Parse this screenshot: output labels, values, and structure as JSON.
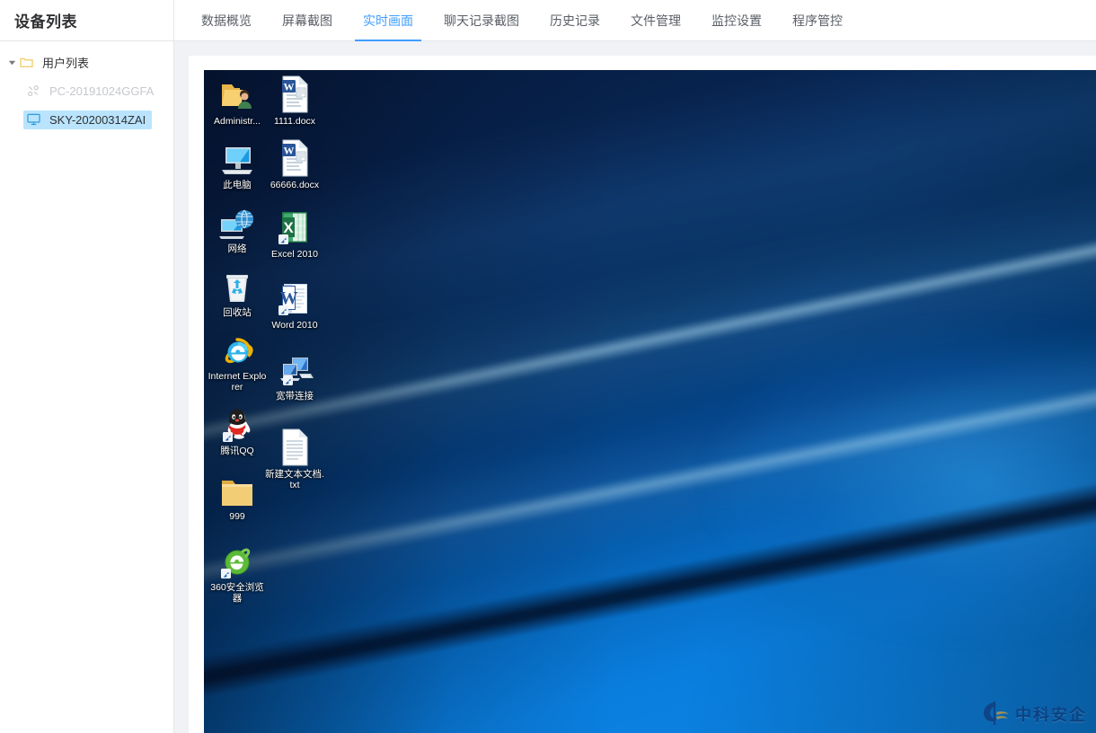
{
  "sidebar": {
    "title": "设备列表",
    "tree": {
      "root": {
        "label": "用户列表",
        "icon": "folder-icon",
        "expanded": true,
        "caret": "caret-down-icon"
      },
      "children": [
        {
          "label": "PC-20191024GGFA",
          "icon": "broken-link-icon",
          "status": "offline",
          "selected": false
        },
        {
          "label": "SKY-20200314ZAI",
          "icon": "monitor-icon",
          "status": "online",
          "selected": true
        }
      ]
    }
  },
  "tabs": [
    {
      "label": "数据概览",
      "active": false
    },
    {
      "label": "屏幕截图",
      "active": false
    },
    {
      "label": "实时画面",
      "active": true
    },
    {
      "label": "聊天记录截图",
      "active": false
    },
    {
      "label": "历史记录",
      "active": false
    },
    {
      "label": "文件管理",
      "active": false
    },
    {
      "label": "监控设置",
      "active": false
    },
    {
      "label": "程序管控",
      "active": false
    }
  ],
  "screen": {
    "desktop_icons_col1": [
      {
        "label": "Administr...",
        "icon": "user-folder-icon"
      },
      {
        "label": "此电脑",
        "icon": "this-pc-icon"
      },
      {
        "label": "网络",
        "icon": "network-icon"
      },
      {
        "label": "回收站",
        "icon": "recycle-bin-icon"
      },
      {
        "label": "Internet Explorer",
        "icon": "internet-explorer-icon"
      },
      {
        "label": "腾讯QQ",
        "icon": "tencent-qq-icon"
      },
      {
        "label": "999",
        "icon": "folder-icon"
      },
      {
        "label": "360安全浏览器",
        "icon": "360-browser-icon"
      }
    ],
    "desktop_icons_col2": [
      {
        "label": "1111.docx",
        "icon": "word-document-icon"
      },
      {
        "label": "66666.docx",
        "icon": "word-document-icon"
      },
      {
        "label": "Excel 2010",
        "icon": "excel-app-icon"
      },
      {
        "label": "Word 2010",
        "icon": "word-app-icon"
      },
      {
        "label": "宽带连接",
        "icon": "broadband-connection-icon"
      },
      {
        "label": "新建文本文档.txt",
        "icon": "text-document-icon"
      }
    ],
    "watermark": "中科安企",
    "cursor": "mouse-pointer-icon"
  },
  "colors": {
    "accent": "#409eff",
    "selected_row": "#bae4fd",
    "tab_inactive_text": "#5a5e66",
    "offline_text": "#c6c8cc",
    "page_bg": "#f0f2f5",
    "wallpaper_dark": "#071a3d",
    "wallpaper_light": "#0d86e8",
    "watermark_text": "#0f2f6e"
  }
}
